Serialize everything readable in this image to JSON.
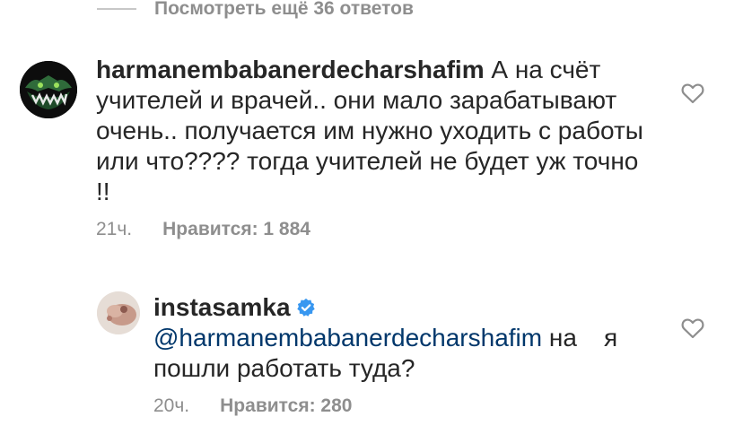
{
  "view_more": {
    "label": "Посмотреть ещё 36 ответов"
  },
  "comments": [
    {
      "username": "harmanembabanerdecharshafim",
      "text": "А на счёт учителей и врачей.. они мало зарабатывают очень.. получается им нужно уходить с работы или что???? тогда учителей не будет уж точно !!",
      "time": "21ч.",
      "likes": "Нравится: 1 884",
      "avatar_icon": "green-monster-avatar-icon"
    },
    {
      "username": "instasamka",
      "verified": true,
      "mention": "@harmanembabanerdecharshafim",
      "text_part1": "на",
      "text_part2": "я пошли работать туда?",
      "time": "20ч.",
      "likes": "Нравится: 280",
      "avatar_icon": "profile-photo-avatar-icon"
    }
  ],
  "colors": {
    "text": "#262626",
    "secondary": "#8e8e8e",
    "mention": "#00376b",
    "verified": "#3897f0"
  }
}
